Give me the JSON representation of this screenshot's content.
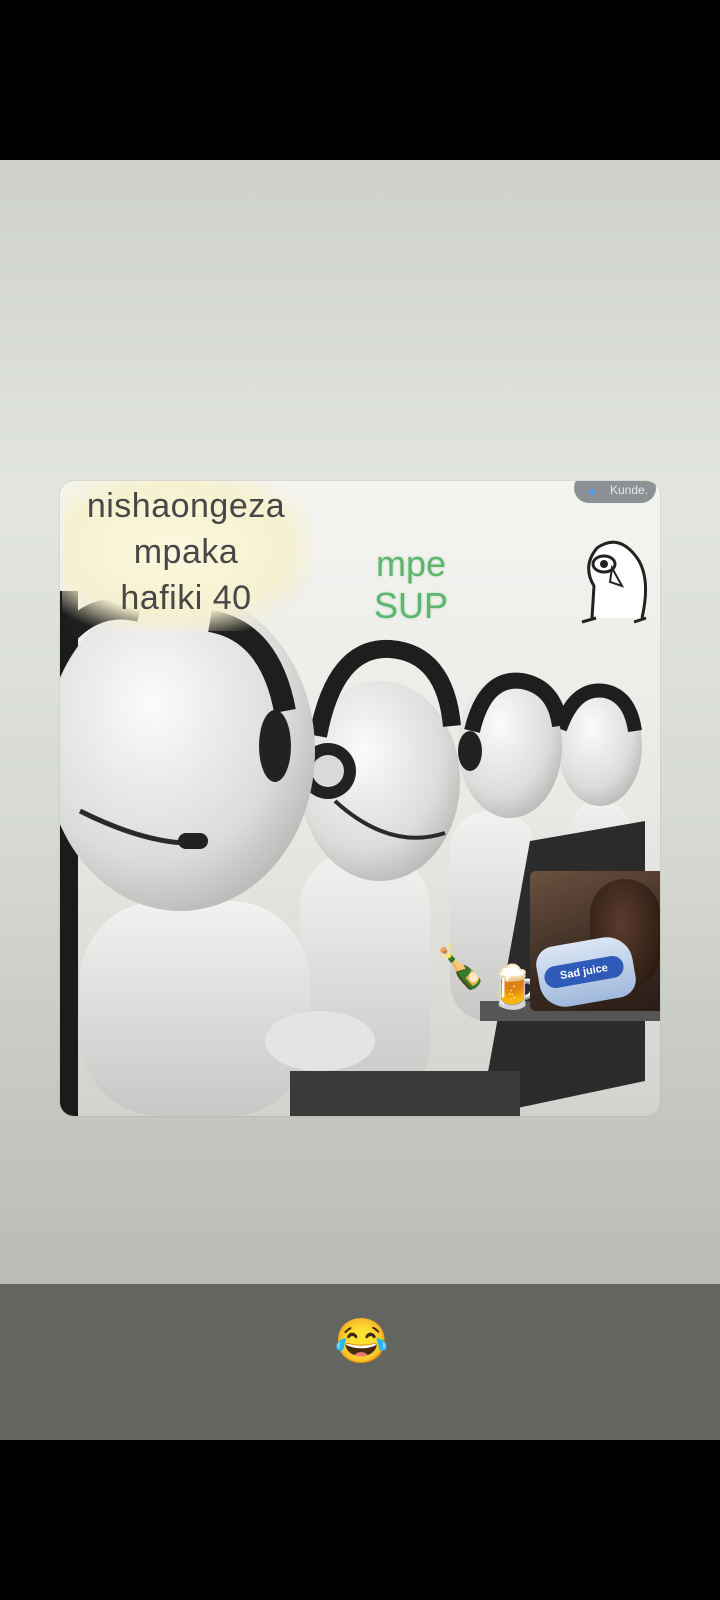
{
  "meme": {
    "caption_lines": [
      "nishaongeza",
      "mpaka",
      "hafiki 40"
    ],
    "reply_lines": [
      "mpe",
      "SUP"
    ],
    "watermark": "Kunde.",
    "sticker_label": "Sad juice",
    "drink_icons": [
      "bottle-with-popping-cork-icon",
      "beer-mug-icon"
    ]
  },
  "reaction": {
    "emoji": "😂",
    "emoji_name": "face-with-tears-of-joy-icon"
  },
  "colors": {
    "caption_text": "#474747",
    "reply_text": "#5db56e",
    "reaction_bar": "#636660"
  }
}
